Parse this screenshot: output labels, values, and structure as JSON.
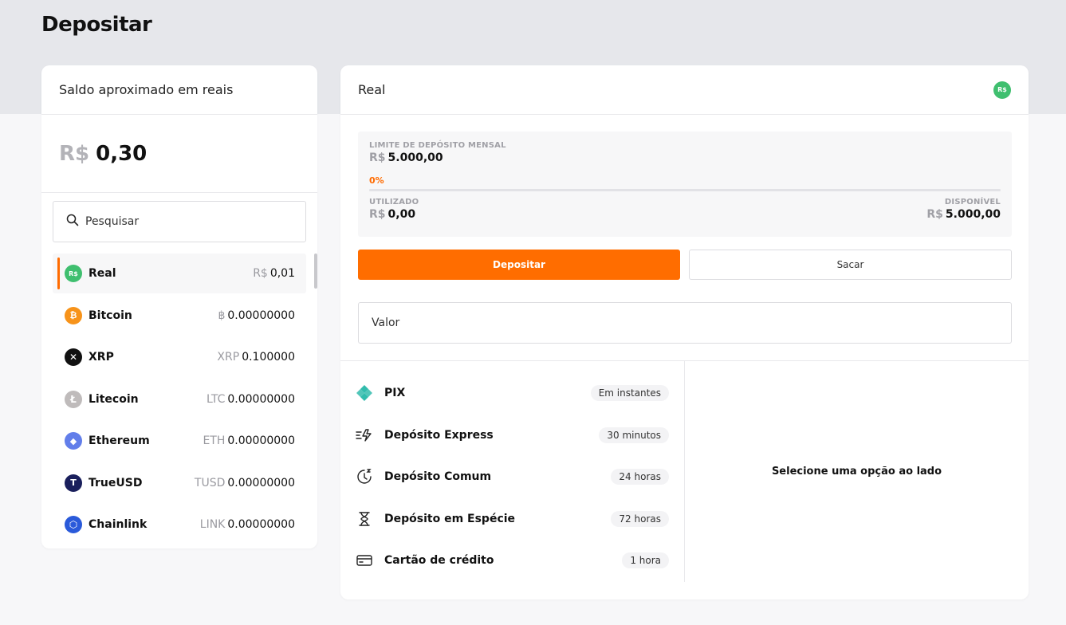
{
  "page": {
    "title": "Depositar"
  },
  "colors": {
    "accent": "#ff6b00",
    "brl": "#3fbf6f",
    "bitcoin": "#f7931a",
    "xrp": "#111111",
    "litecoin": "#bfbbbb",
    "ethereum": "#627eea",
    "trueusd": "#1a1f5c",
    "chainlink": "#2a5ada",
    "pix": "#32bcad"
  },
  "left": {
    "header": "Saldo aproximado em reais",
    "balance": {
      "prefix": "R$",
      "value": "0,30"
    },
    "search": {
      "placeholder": "Pesquisar"
    },
    "coins": [
      {
        "name": "Real",
        "symbol": "R$",
        "balance": "0,01",
        "icon": "real-icon",
        "icon_text": "R$",
        "active": true
      },
      {
        "name": "Bitcoin",
        "symbol": "฿",
        "balance": "0.00000000",
        "icon": "bitcoin-icon",
        "icon_text": "₿"
      },
      {
        "name": "XRP",
        "symbol": "XRP",
        "balance": "0.100000",
        "icon": "xrp-icon",
        "icon_text": "✕"
      },
      {
        "name": "Litecoin",
        "symbol": "LTC",
        "balance": "0.00000000",
        "icon": "litecoin-icon",
        "icon_text": "Ł"
      },
      {
        "name": "Ethereum",
        "symbol": "ETH",
        "balance": "0.00000000",
        "icon": "ethereum-icon",
        "icon_text": "◆"
      },
      {
        "name": "TrueUSD",
        "symbol": "TUSD",
        "balance": "0.00000000",
        "icon": "trueusd-icon",
        "icon_text": "T"
      },
      {
        "name": "Chainlink",
        "symbol": "LINK",
        "balance": "0.00000000",
        "icon": "chainlink-icon",
        "icon_text": "⬡"
      }
    ]
  },
  "right": {
    "header": "Real",
    "badge": "R$",
    "limit": {
      "label": "LIMITE DE DEPÓSITO MENSAL",
      "symbol": "R$",
      "value": "5.000,00",
      "percent": "0%",
      "progress": 0,
      "used_label": "UTILIZADO",
      "used_value": "0,00",
      "available_label": "DISPONÍVEL",
      "available_value": "5.000,00"
    },
    "buttons": {
      "deposit": "Depositar",
      "withdraw": "Sacar"
    },
    "amount": {
      "placeholder": "Valor"
    },
    "methods": [
      {
        "name": "PIX",
        "time": "Em instantes",
        "icon": "pix-icon"
      },
      {
        "name": "Depósito Express",
        "time": "30 minutos",
        "icon": "express-icon"
      },
      {
        "name": "Depósito Comum",
        "time": "24 horas",
        "icon": "clock-icon"
      },
      {
        "name": "Depósito em Espécie",
        "time": "72 horas",
        "icon": "hourglass-icon"
      },
      {
        "name": "Cartão de crédito",
        "time": "1 hora",
        "icon": "credit-card-icon"
      }
    ],
    "select_message": "Selecione uma opção ao lado"
  }
}
